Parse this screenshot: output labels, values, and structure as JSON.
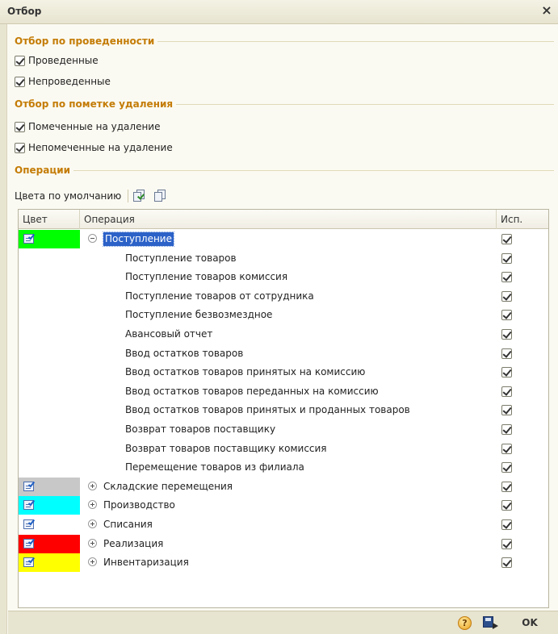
{
  "window": {
    "title": "Отбор",
    "close_glyph": "×"
  },
  "groups": {
    "posting": {
      "title": "Отбор по проведенности",
      "options": [
        {
          "label": "Проведенные",
          "checked": true
        },
        {
          "label": "Непроведенные",
          "checked": true
        }
      ]
    },
    "deletion": {
      "title": "Отбор по пометке удаления",
      "options": [
        {
          "label": "Помеченные на удаление",
          "checked": true
        },
        {
          "label": "Непомеченные на удаление",
          "checked": true
        }
      ]
    },
    "operations": {
      "title": "Операции"
    }
  },
  "toolbar": {
    "default_colors_label": "Цвета по умолчанию",
    "icons": [
      "check-all-icon",
      "uncheck-all-icon"
    ]
  },
  "table": {
    "columns": [
      "Цвет",
      "Операция",
      "Исп."
    ],
    "rows": [
      {
        "label": "Поступление",
        "level": 0,
        "expander": "minus",
        "color": "#00ff00",
        "checked": true,
        "selected": true
      },
      {
        "label": "Поступление товаров",
        "level": 1,
        "checked": true
      },
      {
        "label": "Поступление товаров комиссия",
        "level": 1,
        "checked": true
      },
      {
        "label": "Поступление товаров от сотрудника",
        "level": 1,
        "checked": true
      },
      {
        "label": "Поступление безвозмездное",
        "level": 1,
        "checked": true
      },
      {
        "label": "Авансовый отчет",
        "level": 1,
        "checked": true
      },
      {
        "label": "Ввод остатков товаров",
        "level": 1,
        "checked": true
      },
      {
        "label": "Ввод остатков товаров принятых на комиссию",
        "level": 1,
        "checked": true
      },
      {
        "label": "Ввод остатков товаров переданных на комиссию",
        "level": 1,
        "checked": true
      },
      {
        "label": "Ввод остатков товаров принятых и проданных товаров",
        "level": 1,
        "checked": true
      },
      {
        "label": "Возврат товаров поставщику",
        "level": 1,
        "checked": true
      },
      {
        "label": "Возврат товаров поставщику комиссия",
        "level": 1,
        "checked": true
      },
      {
        "label": "Перемещение товаров из филиала",
        "level": 1,
        "checked": true
      },
      {
        "label": "Складские перемещения",
        "level": 0,
        "expander": "plus",
        "color": "#c8c8c8",
        "checked": true
      },
      {
        "label": "Производство",
        "level": 0,
        "expander": "plus",
        "color": "#00ffff",
        "checked": true
      },
      {
        "label": "Списания",
        "level": 0,
        "expander": "plus",
        "color": "#ffffff",
        "checked": true
      },
      {
        "label": "Реализация",
        "level": 0,
        "expander": "plus",
        "color": "#ff0000",
        "checked": true
      },
      {
        "label": "Инвентаризация",
        "level": 0,
        "expander": "plus",
        "color": "#ffff00",
        "checked": true
      }
    ]
  },
  "footer": {
    "help_glyph": "?",
    "ok_label": "OK"
  },
  "colors": {
    "group_title": "#c47c06",
    "selection": "#2c62c8"
  }
}
